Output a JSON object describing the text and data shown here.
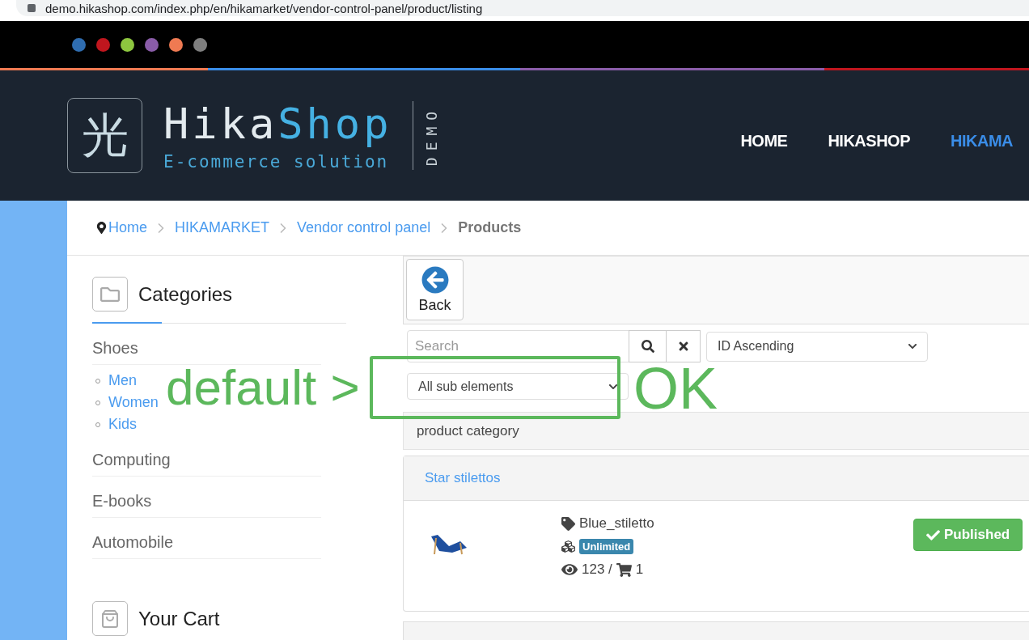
{
  "address_bar": {
    "url": "demo.hikashop.com/index.php/en/hikamarket/vendor-control-panel/product/listing"
  },
  "theme_dots": [
    {
      "color": "#2f6db0"
    },
    {
      "color": "#c0161e"
    },
    {
      "color": "#8dc63f"
    },
    {
      "color": "#8a5ca8"
    },
    {
      "color": "#ef7a52"
    },
    {
      "color": "#7f7f7f"
    }
  ],
  "header": {
    "logo": {
      "glyph": "光",
      "name_part_1": "Hika",
      "name_part_2": "Shop",
      "tagline": "E-commerce solution",
      "badge": "DEMO"
    },
    "nav": [
      {
        "label": "HOME",
        "selected": false
      },
      {
        "label": "HIKASHOP",
        "selected": false
      },
      {
        "label": "HIKAMA",
        "selected": true
      }
    ]
  },
  "breadcrumb": [
    {
      "label": "Home",
      "kind": "link"
    },
    {
      "label": "HIKAMARKET",
      "kind": "link"
    },
    {
      "label": "Vendor control panel",
      "kind": "link"
    },
    {
      "label": "Products",
      "kind": "current"
    }
  ],
  "sidebar": {
    "title": "Categories",
    "categories": [
      {
        "label": "Shoes",
        "children": [
          {
            "label": "Men"
          },
          {
            "label": "Women"
          },
          {
            "label": "Kids"
          }
        ]
      },
      {
        "label": "Computing"
      },
      {
        "label": "E-books"
      },
      {
        "label": "Automobile"
      }
    ],
    "cart": {
      "title": "Your Cart"
    }
  },
  "main": {
    "toolbar": {
      "back": "Back"
    },
    "search": {
      "placeholder": "Search"
    },
    "sort": {
      "value": "ID Ascending"
    },
    "depth_filter": {
      "value": "All sub elements"
    },
    "category_bar": "product category",
    "products": [
      {
        "category": "Star stilettos",
        "name": "Blue_stiletto",
        "stock": "Unlimited",
        "views": "123 /",
        "cart_count": "1",
        "published": true,
        "status": "Published"
      }
    ]
  },
  "annotation": {
    "left": "default >",
    "right": "OK"
  }
}
